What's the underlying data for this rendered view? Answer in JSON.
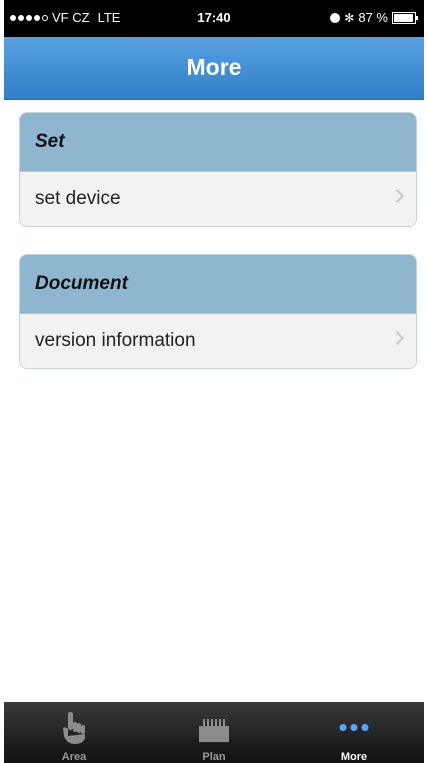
{
  "status_bar": {
    "carrier": "VF CZ",
    "network": "LTE",
    "time": "17:40",
    "battery": "87 %"
  },
  "nav": {
    "title": "More"
  },
  "sections": [
    {
      "header": "Set",
      "item": "set device"
    },
    {
      "header": "Document",
      "item": "version information"
    }
  ],
  "tab_bar": {
    "tabs": [
      {
        "label": "Area",
        "icon": "hand-icon",
        "active": false
      },
      {
        "label": "Plan",
        "icon": "plan-icon",
        "active": false
      },
      {
        "label": "More",
        "icon": "more-icon",
        "active": true
      }
    ]
  },
  "colors": {
    "nav_blue": "#3f8ad2",
    "section_header": "#8fb6cf",
    "tab_active_dots": "#58a7ff"
  }
}
